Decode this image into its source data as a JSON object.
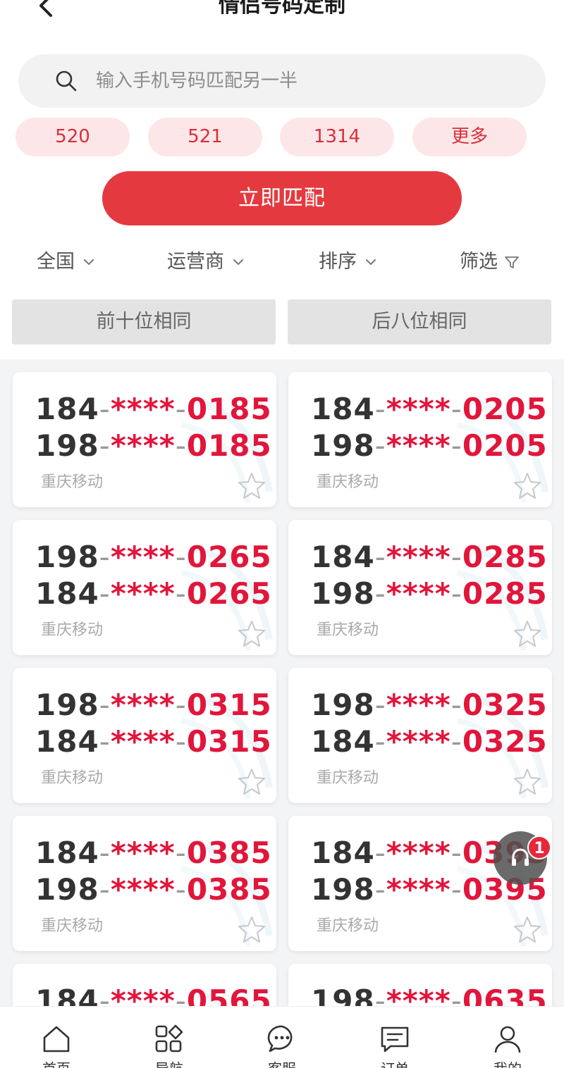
{
  "header": {
    "title": "情侣号码定制"
  },
  "search": {
    "placeholder": "输入手机号码匹配另一半"
  },
  "chips": [
    "520",
    "521",
    "1314",
    "更多"
  ],
  "match_button": "立即匹配",
  "filters": [
    "全国",
    "运营商",
    "排序",
    "筛选"
  ],
  "segments": [
    "前十位相同",
    "后八位相同"
  ],
  "cards": [
    {
      "lines": [
        {
          "pre": "184",
          "mask": "****",
          "suf": "0185"
        },
        {
          "pre": "198",
          "mask": "****",
          "suf": "0185"
        }
      ],
      "carrier": "重庆移动"
    },
    {
      "lines": [
        {
          "pre": "184",
          "mask": "****",
          "suf": "0205"
        },
        {
          "pre": "198",
          "mask": "****",
          "suf": "0205"
        }
      ],
      "carrier": "重庆移动"
    },
    {
      "lines": [
        {
          "pre": "198",
          "mask": "****",
          "suf": "0265"
        },
        {
          "pre": "184",
          "mask": "****",
          "suf": "0265"
        }
      ],
      "carrier": "重庆移动"
    },
    {
      "lines": [
        {
          "pre": "184",
          "mask": "****",
          "suf": "0285"
        },
        {
          "pre": "198",
          "mask": "****",
          "suf": "0285"
        }
      ],
      "carrier": "重庆移动"
    },
    {
      "lines": [
        {
          "pre": "198",
          "mask": "****",
          "suf": "0315"
        },
        {
          "pre": "184",
          "mask": "****",
          "suf": "0315"
        }
      ],
      "carrier": "重庆移动"
    },
    {
      "lines": [
        {
          "pre": "198",
          "mask": "****",
          "suf": "0325"
        },
        {
          "pre": "184",
          "mask": "****",
          "suf": "0325"
        }
      ],
      "carrier": "重庆移动"
    },
    {
      "lines": [
        {
          "pre": "184",
          "mask": "****",
          "suf": "0385"
        },
        {
          "pre": "198",
          "mask": "****",
          "suf": "0385"
        }
      ],
      "carrier": "重庆移动"
    },
    {
      "lines": [
        {
          "pre": "184",
          "mask": "****",
          "suf": "0395"
        },
        {
          "pre": "198",
          "mask": "****",
          "suf": "0395"
        }
      ],
      "carrier": "重庆移动"
    },
    {
      "lines": [
        {
          "pre": "184",
          "mask": "****",
          "suf": "0565"
        }
      ],
      "carrier": ""
    },
    {
      "lines": [
        {
          "pre": "198",
          "mask": "****",
          "suf": "0635"
        }
      ],
      "carrier": ""
    }
  ],
  "cs_badge": "1",
  "tabbar": [
    "首页",
    "导航",
    "客服",
    "订单",
    "我的"
  ],
  "colors": {
    "accent": "#e43a3f",
    "number_red": "#e1163b",
    "chip_bg": "#fde6e8"
  }
}
